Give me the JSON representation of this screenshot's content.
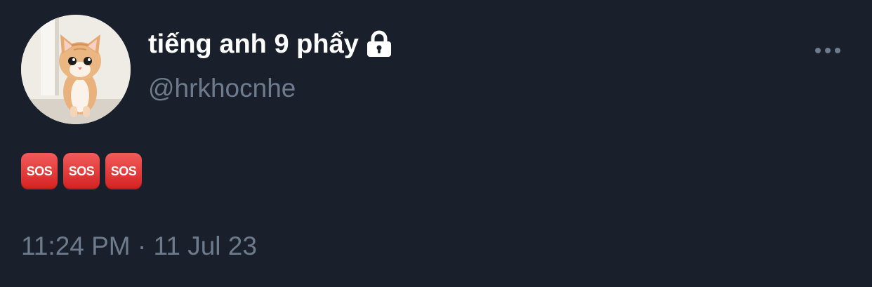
{
  "tweet": {
    "author": {
      "display_name": "tiếng anh 9 phẩy",
      "handle": "@hrkhocnhe",
      "avatar": "cat-avatar",
      "protected_icon": "lock-icon"
    },
    "more_icon": "more-dots-icon",
    "body": {
      "emojis": [
        "SOS",
        "SOS",
        "SOS"
      ]
    },
    "timestamp": "11:24 PM · 11 Jul 23"
  },
  "colors": {
    "background": "#1a202b",
    "primary_text": "#ffffff",
    "secondary_text": "#6e7b8c",
    "sos_red": "#e23b3b"
  }
}
